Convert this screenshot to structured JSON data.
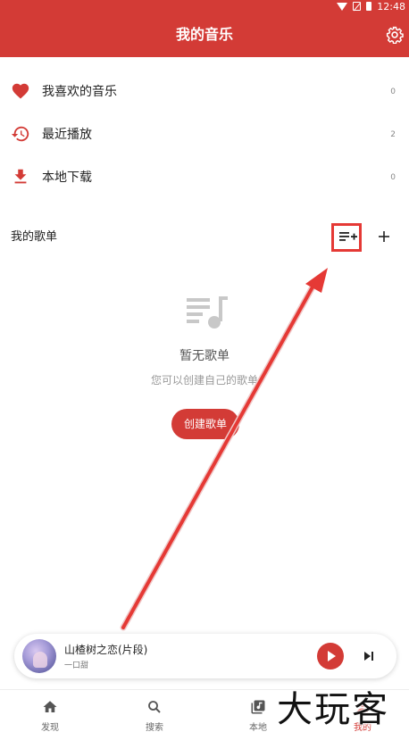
{
  "status_bar": {
    "time": "12:48"
  },
  "app_bar": {
    "title": "我的音乐"
  },
  "menu": [
    {
      "label": "我喜欢的音乐",
      "count": "0",
      "icon": "heart-icon"
    },
    {
      "label": "最近播放",
      "count": "2",
      "icon": "history-icon"
    },
    {
      "label": "本地下载",
      "count": "0",
      "icon": "download-icon"
    }
  ],
  "playlists": {
    "section_title": "我的歌单",
    "empty_title": "暂无歌单",
    "empty_subtitle": "您可以创建自己的歌单",
    "create_label": "创建歌单"
  },
  "player": {
    "title": "山楂树之恋(片段)",
    "artist": "一口甜"
  },
  "bottom_nav": [
    {
      "label": "发现",
      "icon": "home-icon",
      "active": false
    },
    {
      "label": "搜索",
      "icon": "search-icon",
      "active": false
    },
    {
      "label": "本地",
      "icon": "local-music-icon",
      "active": false
    },
    {
      "label": "我的",
      "icon": "profile-icon",
      "active": true
    }
  ],
  "watermark": "大玩客",
  "colors": {
    "accent": "#d33b36",
    "highlight": "#e53935"
  }
}
